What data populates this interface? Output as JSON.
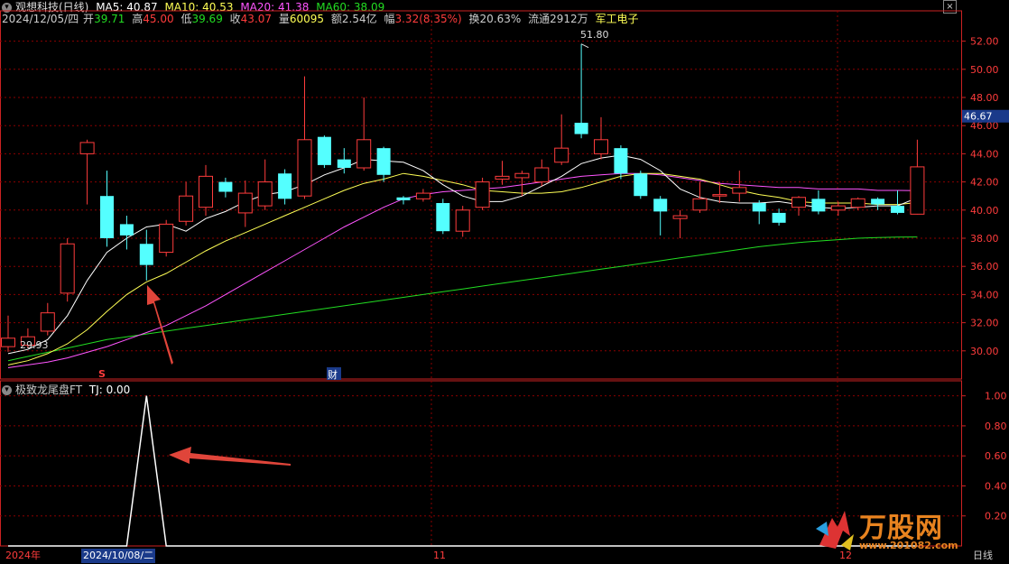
{
  "header": {
    "title": "观想科技(日线)",
    "ma5": "MA5: 40.87",
    "ma10": "MA10: 40.53",
    "ma20": "MA20: 41.38",
    "ma60": "MA60: 38.09",
    "date": "2024/12/05/四",
    "open_label": "开",
    "open": "39.71",
    "high_label": "高",
    "high": "45.00",
    "low_label": "低",
    "low": "39.69",
    "close_label": "收",
    "close": "43.07",
    "vol_label": "量",
    "vol": "60095",
    "amt_label": "额",
    "amt": "2.54亿",
    "chg_label": "幅",
    "chg": "3.32(8.35%)",
    "turn_label": "换",
    "turn": "20.63%",
    "float_label": "流通",
    "float": "2912万",
    "sector": "军工电子",
    "close_button": "×"
  },
  "indicator": {
    "name": "极致龙尾盘FT",
    "tj": "TJ: 0.00"
  },
  "colors": {
    "up": "#ff3c3c",
    "down": "#54ffff",
    "ma5": "#ffffff",
    "ma10": "#ffff55",
    "ma20": "#ff55ff",
    "ma60": "#22dd22",
    "grid": "#8b0000",
    "axis": "#cc2222"
  },
  "price_axis": {
    "labels": [
      "52.00",
      "50.00",
      "48.00",
      "46.00",
      "44.00",
      "42.00",
      "40.00",
      "38.00",
      "36.00",
      "34.00",
      "32.00",
      "30.00"
    ],
    "current": "46.67"
  },
  "ind_axis": {
    "labels": [
      "1.00",
      "0.80",
      "0.60",
      "0.40",
      "0.20"
    ]
  },
  "annotations": {
    "high_mark": "51.80",
    "low_mark": "29.93",
    "s_marker": "S",
    "cai_marker": "财"
  },
  "time_axis": {
    "year": "2024年",
    "cursor_date": "2024/10/08/二",
    "month_11": "11",
    "month_12": "12",
    "period": "日线"
  },
  "watermark": {
    "brand": "万股网",
    "url": "www.201082.com"
  },
  "chart_data": {
    "type": "candlestick",
    "ylim": [
      28,
      53
    ],
    "candles": [
      {
        "o": 30.3,
        "c": 30.9,
        "h": 32.5,
        "l": 29.93
      },
      {
        "o": 30.4,
        "c": 31.0,
        "h": 31.6,
        "l": 30.2
      },
      {
        "o": 31.4,
        "c": 32.7,
        "h": 33.4,
        "l": 31.1
      },
      {
        "o": 34.1,
        "c": 37.6,
        "h": 38.0,
        "l": 33.5
      },
      {
        "o": 44.0,
        "c": 44.8,
        "h": 45.0,
        "l": 40.4
      },
      {
        "o": 41.0,
        "c": 38.0,
        "h": 42.8,
        "l": 37.4
      },
      {
        "o": 39.0,
        "c": 38.2,
        "h": 39.6,
        "l": 37.2
      },
      {
        "o": 37.6,
        "c": 36.1,
        "h": 38.6,
        "l": 35.0
      },
      {
        "o": 37.0,
        "c": 39.0,
        "h": 39.3,
        "l": 36.7
      },
      {
        "o": 39.2,
        "c": 41.0,
        "h": 42.0,
        "l": 38.9
      },
      {
        "o": 40.2,
        "c": 42.4,
        "h": 43.2,
        "l": 39.6
      },
      {
        "o": 42.0,
        "c": 41.3,
        "h": 42.3,
        "l": 40.9
      },
      {
        "o": 39.8,
        "c": 41.2,
        "h": 42.1,
        "l": 38.8
      },
      {
        "o": 40.3,
        "c": 42.0,
        "h": 43.6,
        "l": 40.0
      },
      {
        "o": 42.6,
        "c": 40.8,
        "h": 42.9,
        "l": 40.4
      },
      {
        "o": 41.0,
        "c": 45.0,
        "h": 49.5,
        "l": 40.8
      },
      {
        "o": 45.2,
        "c": 43.2,
        "h": 45.3,
        "l": 43.0
      },
      {
        "o": 43.6,
        "c": 43.0,
        "h": 44.4,
        "l": 42.6
      },
      {
        "o": 43.0,
        "c": 45.0,
        "h": 48.0,
        "l": 42.8
      },
      {
        "o": 44.4,
        "c": 42.5,
        "h": 44.5,
        "l": 42.0
      },
      {
        "o": 40.9,
        "c": 40.7,
        "h": 41.0,
        "l": 40.4
      },
      {
        "o": 40.8,
        "c": 41.2,
        "h": 41.5,
        "l": 40.6
      },
      {
        "o": 40.5,
        "c": 38.5,
        "h": 40.8,
        "l": 38.3
      },
      {
        "o": 38.5,
        "c": 40.0,
        "h": 40.3,
        "l": 38.1
      },
      {
        "o": 40.2,
        "c": 42.0,
        "h": 42.3,
        "l": 40.0
      },
      {
        "o": 42.2,
        "c": 42.4,
        "h": 43.5,
        "l": 41.8
      },
      {
        "o": 42.3,
        "c": 42.6,
        "h": 42.8,
        "l": 41.0
      },
      {
        "o": 42.0,
        "c": 43.0,
        "h": 43.6,
        "l": 41.7
      },
      {
        "o": 43.4,
        "c": 44.4,
        "h": 46.8,
        "l": 43.2
      },
      {
        "o": 46.2,
        "c": 45.4,
        "h": 51.8,
        "l": 45.1
      },
      {
        "o": 44.0,
        "c": 45.0,
        "h": 46.6,
        "l": 43.6
      },
      {
        "o": 44.4,
        "c": 42.6,
        "h": 44.6,
        "l": 42.2
      },
      {
        "o": 42.6,
        "c": 41.0,
        "h": 42.8,
        "l": 40.8
      },
      {
        "o": 40.8,
        "c": 39.9,
        "h": 41.0,
        "l": 38.2
      },
      {
        "o": 39.4,
        "c": 39.6,
        "h": 40.0,
        "l": 38.0
      },
      {
        "o": 40.0,
        "c": 40.8,
        "h": 42.0,
        "l": 39.8
      },
      {
        "o": 41.0,
        "c": 41.1,
        "h": 42.0,
        "l": 40.5
      },
      {
        "o": 41.2,
        "c": 41.6,
        "h": 42.8,
        "l": 40.6
      },
      {
        "o": 40.5,
        "c": 39.9,
        "h": 40.7,
        "l": 39.0
      },
      {
        "o": 39.8,
        "c": 39.1,
        "h": 40.1,
        "l": 38.9
      },
      {
        "o": 40.2,
        "c": 40.9,
        "h": 41.0,
        "l": 39.6
      },
      {
        "o": 40.8,
        "c": 39.9,
        "h": 41.4,
        "l": 39.7
      },
      {
        "o": 40.0,
        "c": 40.3,
        "h": 40.6,
        "l": 39.6
      },
      {
        "o": 40.2,
        "c": 40.8,
        "h": 40.9,
        "l": 40.0
      },
      {
        "o": 40.8,
        "c": 40.4,
        "h": 40.9,
        "l": 40.0
      },
      {
        "o": 40.3,
        "c": 39.8,
        "h": 41.4,
        "l": 39.7
      },
      {
        "o": 39.71,
        "c": 43.07,
        "h": 45.0,
        "l": 39.69
      }
    ],
    "ma5": [
      29.8,
      30.1,
      30.8,
      32.5,
      35.0,
      37.0,
      38.0,
      38.8,
      39.0,
      38.5,
      39.4,
      39.9,
      40.6,
      41.1,
      41.3,
      41.8,
      42.5,
      43.0,
      43.6,
      43.5,
      43.4,
      42.8,
      41.8,
      41.0,
      40.6,
      40.6,
      41.0,
      41.7,
      42.4,
      43.3,
      43.7,
      43.9,
      43.6,
      42.8,
      41.5,
      40.9,
      40.6,
      40.5,
      40.5,
      40.6,
      40.4,
      40.2,
      40.1,
      40.2,
      40.3,
      40.3,
      40.87
    ],
    "ma10": [
      29.0,
      29.3,
      29.8,
      30.5,
      31.5,
      32.8,
      34.0,
      34.9,
      35.5,
      36.3,
      37.1,
      37.8,
      38.4,
      39.0,
      39.6,
      40.2,
      40.8,
      41.4,
      41.9,
      42.2,
      42.6,
      42.4,
      42.1,
      41.8,
      41.4,
      41.3,
      41.2,
      41.2,
      41.3,
      41.6,
      42.0,
      42.4,
      42.6,
      42.6,
      42.4,
      42.2,
      41.8,
      41.4,
      41.1,
      40.9,
      40.6,
      40.5,
      40.5,
      40.5,
      40.4,
      40.4,
      40.53
    ],
    "ma20": [
      28.8,
      29.0,
      29.2,
      29.5,
      29.9,
      30.3,
      30.8,
      31.3,
      31.8,
      32.5,
      33.2,
      34.0,
      34.8,
      35.6,
      36.4,
      37.2,
      38.0,
      38.8,
      39.5,
      40.2,
      40.8,
      41.1,
      41.3,
      41.4,
      41.5,
      41.6,
      41.8,
      42.0,
      42.2,
      42.4,
      42.5,
      42.6,
      42.6,
      42.5,
      42.3,
      42.1,
      41.9,
      41.8,
      41.7,
      41.6,
      41.6,
      41.5,
      41.5,
      41.5,
      41.4,
      41.4,
      41.38
    ],
    "ma60": [
      29.3,
      29.6,
      29.9,
      30.2,
      30.5,
      30.8,
      31.0,
      31.2,
      31.4,
      31.6,
      31.8,
      32.0,
      32.2,
      32.4,
      32.6,
      32.8,
      33.0,
      33.2,
      33.4,
      33.6,
      33.8,
      34.0,
      34.2,
      34.4,
      34.6,
      34.8,
      35.0,
      35.2,
      35.4,
      35.6,
      35.8,
      36.0,
      36.2,
      36.4,
      36.6,
      36.8,
      37.0,
      37.2,
      37.4,
      37.55,
      37.7,
      37.8,
      37.9,
      38.0,
      38.05,
      38.08,
      38.09
    ],
    "indicator": {
      "ylim": [
        0,
        1.1
      ],
      "spike_index": 7,
      "spike_value": 1.0,
      "values_other": 0
    }
  }
}
